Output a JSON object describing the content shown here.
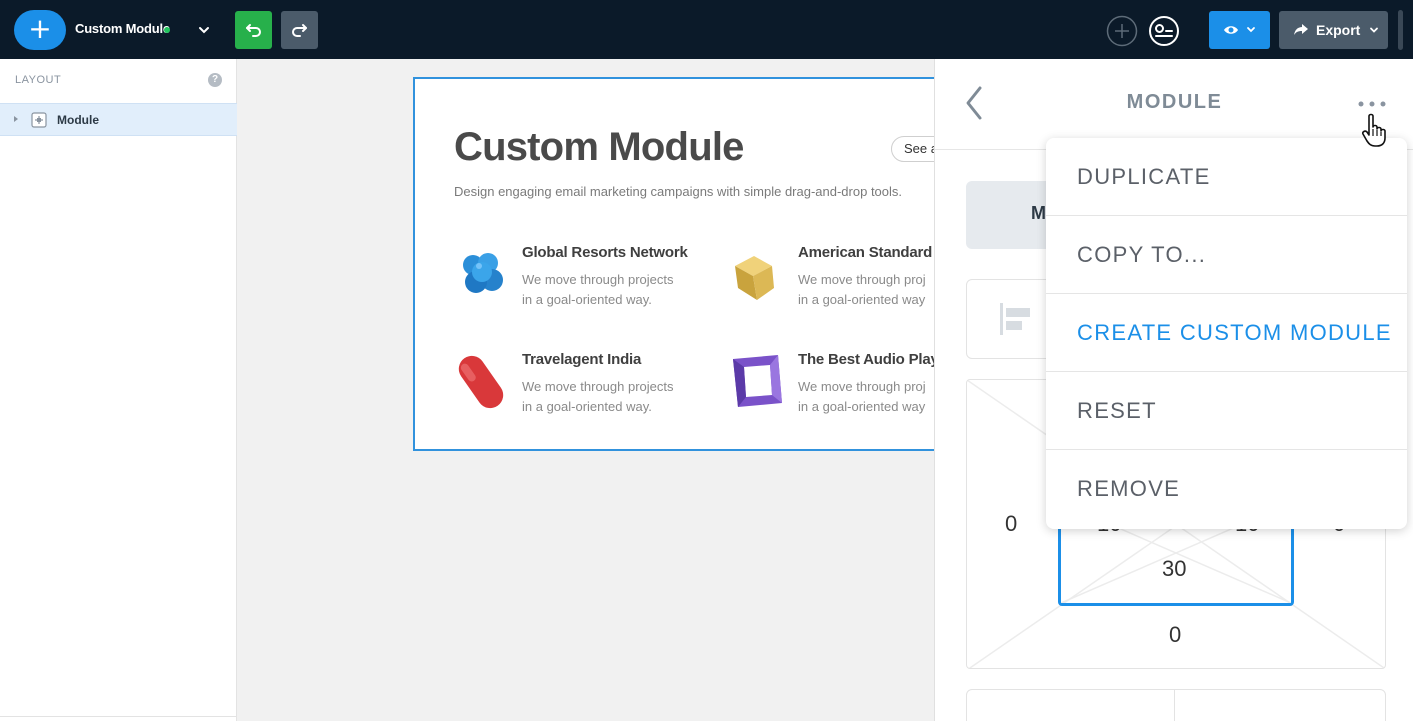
{
  "topbar": {
    "add_label": "+",
    "project_name": "Custom Module",
    "export_label": "Export"
  },
  "layout_panel": {
    "title": "LAYOUT",
    "help": "?",
    "items": [
      {
        "label": "Module"
      }
    ]
  },
  "module": {
    "title": "Custom Module",
    "cta": "See a",
    "description": "Design engaging email marketing campaigns with simple drag-and-drop tools.",
    "features": [
      {
        "title": "Global Resorts Network",
        "line1": "We move through projects",
        "line2": "in a goal-oriented way."
      },
      {
        "title": "American Standard",
        "line1": "We move through proj",
        "line2": "in a goal-oriented way"
      },
      {
        "title": "Travelagent India",
        "line1": "We move through projects",
        "line2": "in a goal-oriented way."
      },
      {
        "title": "The Best Audio Play",
        "line1": "We move through proj",
        "line2": "in a goal-oriented way"
      }
    ]
  },
  "settings_panel": {
    "title": "MODULE",
    "tab_label": "M",
    "spacing": {
      "outer_left": "0",
      "inner_top_left": "10",
      "inner_top_right": "10",
      "outer_right": "0",
      "inner_bottom": "30",
      "outer_bottom": "0"
    }
  },
  "menu": {
    "items": [
      {
        "label": "DUPLICATE"
      },
      {
        "label": "COPY TO..."
      },
      {
        "label": "CREATE CUSTOM MODULE"
      },
      {
        "label": "RESET"
      },
      {
        "label": "REMOVE"
      }
    ]
  },
  "colors": {
    "topbar_bg": "#0b1a29",
    "primary": "#1b8fe8",
    "undo_green": "#27b04b",
    "status_online": "#22c55e"
  }
}
